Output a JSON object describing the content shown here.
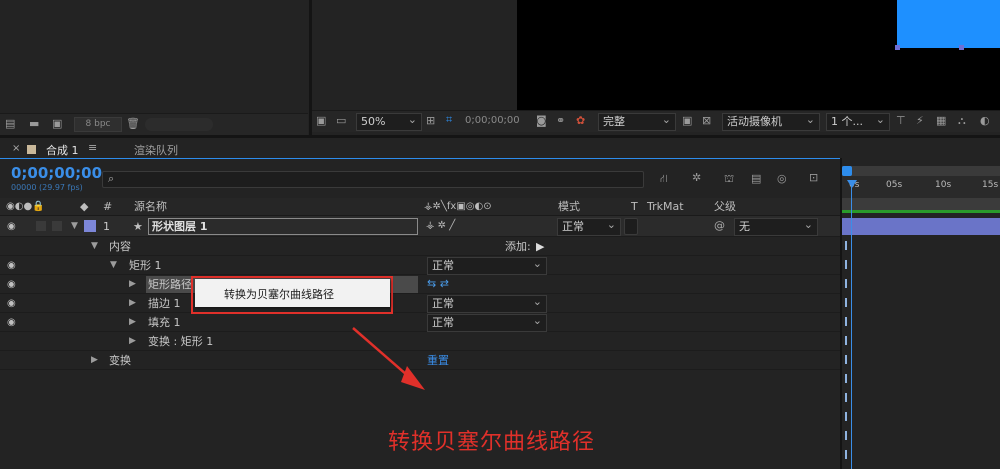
{
  "project": {
    "bpc": "8 bpc"
  },
  "viewer": {
    "zoom": "50%",
    "timecode": "0;00;00;00",
    "resolution": "完整",
    "camera": "活动摄像机",
    "views": "1 个..."
  },
  "timeline": {
    "tab_comp": "合成 1",
    "tab_render": "渲染队列",
    "current_time": "0;00;00;00",
    "fps": "00000 (29.97 fps)",
    "search_placeholder": "",
    "columns": {
      "num": "#",
      "source_name": "源名称",
      "mode": "模式",
      "t": "T",
      "trkmat": "TrkMat",
      "parent": "父级"
    },
    "layer": {
      "index": "1",
      "name": "形状图层 1",
      "mode": "正常",
      "parent": "无"
    },
    "rows": {
      "contents": "内容",
      "add": "添加:",
      "rect": "矩形 1",
      "rect_mode": "正常",
      "rect_path": "矩形路径",
      "stroke": "描边 1",
      "stroke_mode": "正常",
      "fill": "填充 1",
      "fill_mode": "正常",
      "transform_rect": "变换 : 矩形 1",
      "transform": "变换",
      "reset": "重置"
    },
    "ruler": [
      "0s",
      "05s",
      "10s",
      "15s"
    ]
  },
  "context_menu": {
    "item": "转换为贝塞尔曲线路径"
  },
  "annotation": {
    "text": "转换贝塞尔曲线路径",
    "color": "#e0302a"
  },
  "colors": {
    "accent_blue": "#2d8ceb",
    "layer_bar": "#6a74c8",
    "label_lavender": "#7c86d8"
  }
}
